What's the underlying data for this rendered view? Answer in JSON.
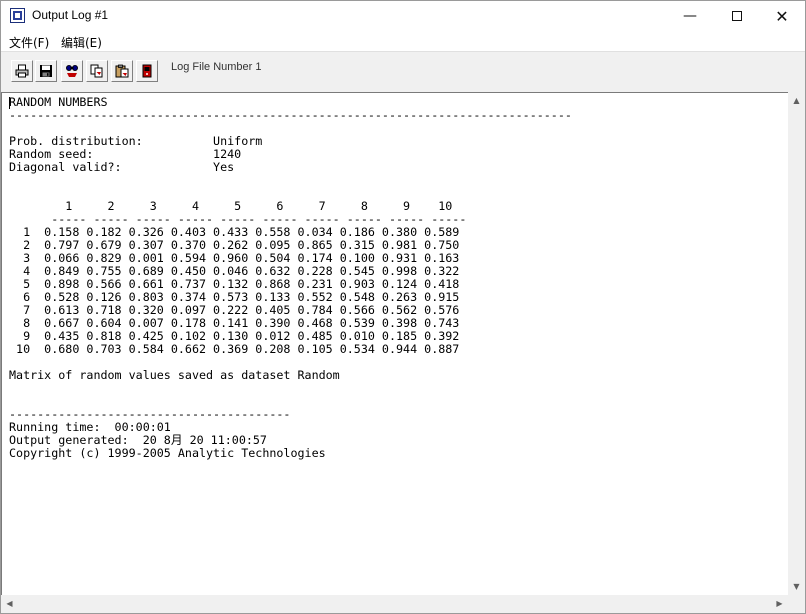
{
  "window": {
    "title": "Output Log #1",
    "minimize_glyph": "—",
    "close_glyph": "✕"
  },
  "menu": {
    "file": "文件(F)",
    "edit": "编辑(E)"
  },
  "toolbar": {
    "buttons": [
      {
        "name": "print-icon"
      },
      {
        "name": "save-icon"
      },
      {
        "name": "find-icon"
      },
      {
        "name": "copy-icon"
      },
      {
        "name": "paste-icon"
      },
      {
        "name": "exit-icon"
      }
    ],
    "log_label": "Log File Number 1"
  },
  "output": {
    "text": "RANDOM NUMBERS\n--------------------------------------------------------------------------------\n\nProb. distribution:          Uniform\nRandom seed:                 1240\nDiagonal valid?:             Yes\n\n\n        1     2     3     4     5     6     7     8     9    10\n      ----- ----- ----- ----- ----- ----- ----- ----- ----- -----\n  1  0.158 0.182 0.326 0.403 0.433 0.558 0.034 0.186 0.380 0.589\n  2  0.797 0.679 0.307 0.370 0.262 0.095 0.865 0.315 0.981 0.750\n  3  0.066 0.829 0.001 0.594 0.960 0.504 0.174 0.100 0.931 0.163\n  4  0.849 0.755 0.689 0.450 0.046 0.632 0.228 0.545 0.998 0.322\n  5  0.898 0.566 0.661 0.737 0.132 0.868 0.231 0.903 0.124 0.418\n  6  0.528 0.126 0.803 0.374 0.573 0.133 0.552 0.548 0.263 0.915\n  7  0.613 0.718 0.320 0.097 0.222 0.405 0.784 0.566 0.562 0.576\n  8  0.667 0.604 0.007 0.178 0.141 0.390 0.468 0.539 0.398 0.743\n  9  0.435 0.818 0.425 0.102 0.130 0.012 0.485 0.010 0.185 0.392\n 10  0.680 0.703 0.584 0.662 0.369 0.208 0.105 0.534 0.944 0.887\n\nMatrix of random values saved as dataset Random\n\n\n----------------------------------------\nRunning time:  00:00:01\nOutput generated:  20 8月 20 11:00:57\nCopyright (c) 1999-2005 Analytic Technologies"
  },
  "scrollbar": {
    "up": "▲",
    "down": "▼",
    "left": "◀",
    "right": "▶"
  }
}
